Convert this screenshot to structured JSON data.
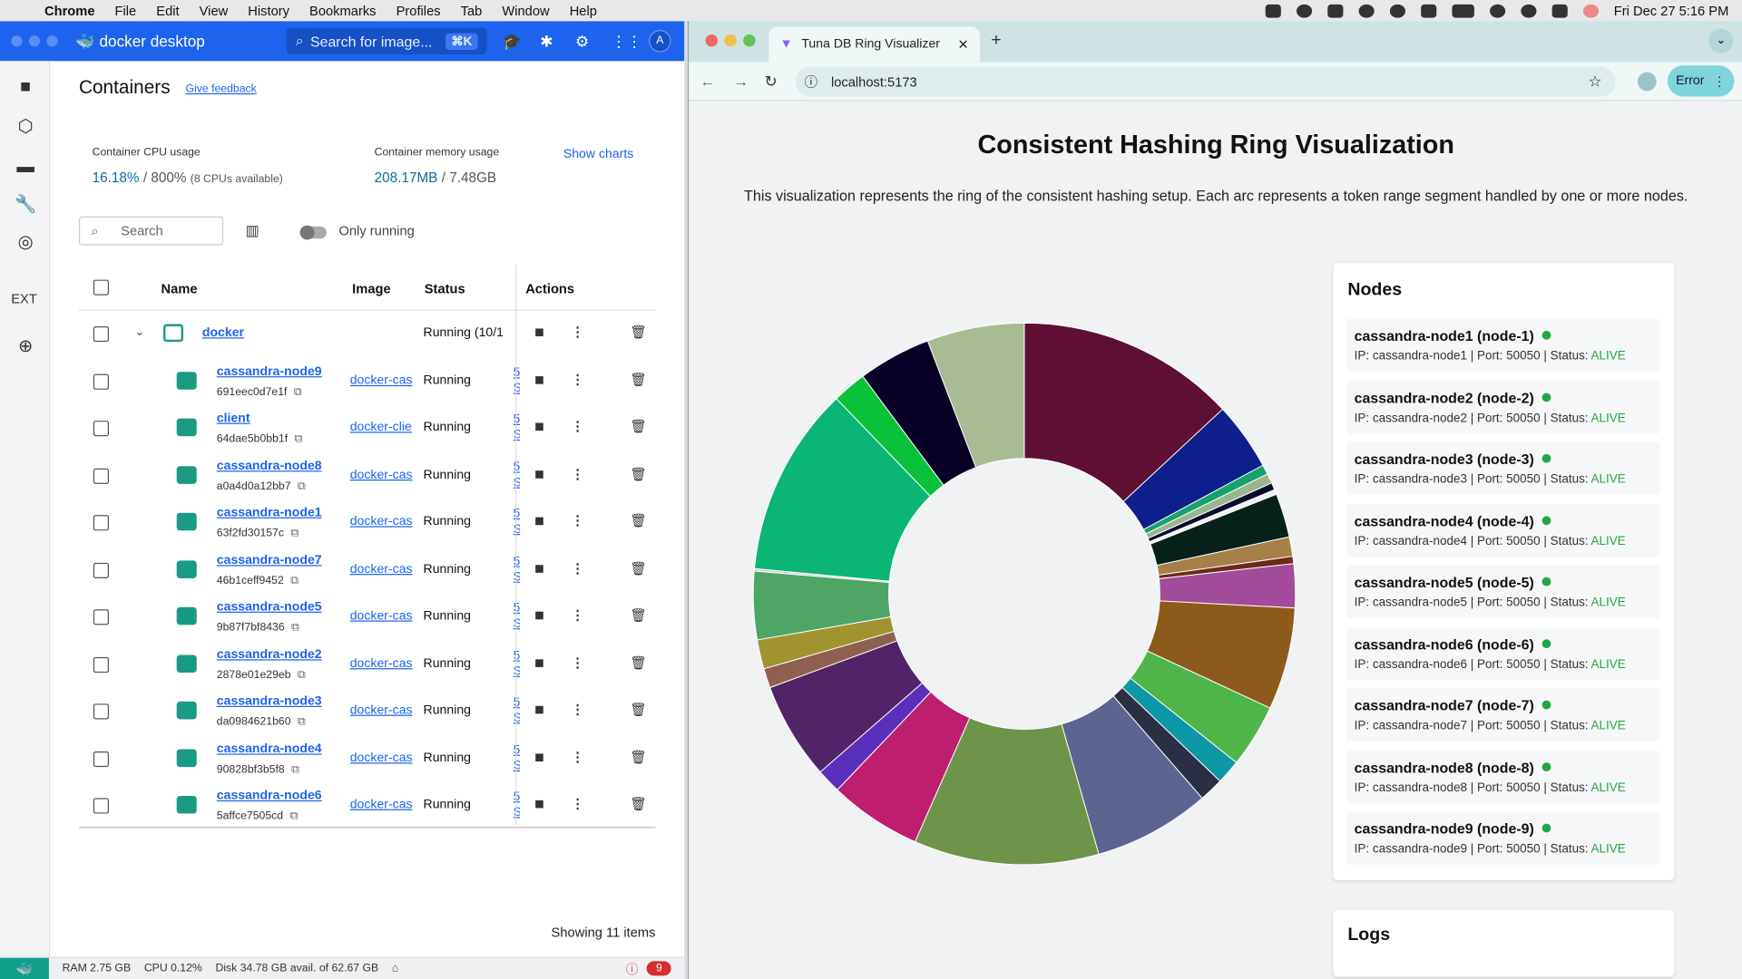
{
  "menubar": {
    "app": "Chrome",
    "items": [
      "File",
      "Edit",
      "View",
      "History",
      "Bookmarks",
      "Profiles",
      "Tab",
      "Window",
      "Help"
    ],
    "clock": "Fri Dec 27  5:16 PM"
  },
  "docker": {
    "logo": "docker desktop",
    "search_placeholder": "Search for image...",
    "search_shortcut": "⌘K",
    "avatar": "A",
    "page_title": "Containers",
    "feedback": "Give feedback",
    "cpu_label": "Container CPU usage",
    "cpu_value": "16.18%",
    "cpu_total": "/ 800%",
    "cpu_note": "(8 CPUs available)",
    "mem_label": "Container memory usage",
    "mem_value": "208.17MB",
    "mem_total": "/ 7.48GB",
    "show_charts": "Show charts",
    "search": "Search",
    "only_running": "Only running",
    "cols": {
      "name": "Name",
      "image": "Image",
      "status": "Status",
      "actions": "Actions"
    },
    "group": {
      "name": "docker",
      "status": "Running (10/1"
    },
    "rows": [
      {
        "name": "cassandra-node9",
        "id": "691eec0d7e1f",
        "image": "docker-cas",
        "status": "Running",
        "port": "5 S"
      },
      {
        "name": "client",
        "id": "64dae5b0bb1f",
        "image": "docker-clie",
        "status": "Running",
        "port": "5 S"
      },
      {
        "name": "cassandra-node8",
        "id": "a0a4d0a12bb7",
        "image": "docker-cas",
        "status": "Running",
        "port": "5 S"
      },
      {
        "name": "cassandra-node1",
        "id": "63f2fd30157c",
        "image": "docker-cas",
        "status": "Running",
        "port": "5 S"
      },
      {
        "name": "cassandra-node7",
        "id": "46b1ceff9452",
        "image": "docker-cas",
        "status": "Running",
        "port": "5 S"
      },
      {
        "name": "cassandra-node5",
        "id": "9b87f7bf8436",
        "image": "docker-cas",
        "status": "Running",
        "port": "5 S"
      },
      {
        "name": "cassandra-node2",
        "id": "2878e01e29eb",
        "image": "docker-cas",
        "status": "Running",
        "port": "5 S"
      },
      {
        "name": "cassandra-node3",
        "id": "da0984621b60",
        "image": "docker-cas",
        "status": "Running",
        "port": "5 S"
      },
      {
        "name": "cassandra-node4",
        "id": "90828bf3b5f8",
        "image": "docker-cas",
        "status": "Running",
        "port": "5 S"
      },
      {
        "name": "cassandra-node6",
        "id": "5affce7505cd",
        "image": "docker-cas",
        "status": "Running",
        "port": "5 S"
      }
    ],
    "showing": "Showing 11 items",
    "status_bar": {
      "ram": "RAM 2.75 GB",
      "cpu": "CPU 0.12%",
      "disk": "Disk 34.78 GB avail. of 62.67 GB",
      "notifications": "9"
    }
  },
  "chrome": {
    "tab_title": "Tuna DB Ring Visualizer",
    "url": "localhost:5173",
    "error_btn": "Error"
  },
  "page": {
    "title": "Consistent Hashing Ring Visualization",
    "description": "This visualization represents the ring of the consistent hashing setup. Each arc represents a token range segment handled by one or more nodes.",
    "nodes_heading": "Nodes",
    "logs_heading": "Logs",
    "nodes": [
      {
        "title": "cassandra-node1 (node-1)",
        "ip": "cassandra-node1",
        "port": "50050",
        "status": "ALIVE"
      },
      {
        "title": "cassandra-node2 (node-2)",
        "ip": "cassandra-node2",
        "port": "50050",
        "status": "ALIVE"
      },
      {
        "title": "cassandra-node3 (node-3)",
        "ip": "cassandra-node3",
        "port": "50050",
        "status": "ALIVE"
      },
      {
        "title": "cassandra-node4 (node-4)",
        "ip": "cassandra-node4",
        "port": "50050",
        "status": "ALIVE"
      },
      {
        "title": "cassandra-node5 (node-5)",
        "ip": "cassandra-node5",
        "port": "50050",
        "status": "ALIVE"
      },
      {
        "title": "cassandra-node6 (node-6)",
        "ip": "cassandra-node6",
        "port": "50050",
        "status": "ALIVE"
      },
      {
        "title": "cassandra-node7 (node-7)",
        "ip": "cassandra-node7",
        "port": "50050",
        "status": "ALIVE"
      },
      {
        "title": "cassandra-node8 (node-8)",
        "ip": "cassandra-node8",
        "port": "50050",
        "status": "ALIVE"
      },
      {
        "title": "cassandra-node9 (node-9)",
        "ip": "cassandra-node9",
        "port": "50050",
        "status": "ALIVE"
      }
    ]
  },
  "chart_data": {
    "type": "pie",
    "donut": true,
    "segments_deg": [
      {
        "value": 45,
        "color": "#5e0f33"
      },
      {
        "value": 14,
        "color": "#0c1f8a"
      },
      {
        "value": 2,
        "color": "#15a36b"
      },
      {
        "value": 2,
        "color": "#9ab58f"
      },
      {
        "value": 1.5,
        "color": "#0a0a2e"
      },
      {
        "value": 1,
        "color": "#f0f0f0"
      },
      {
        "value": 9,
        "color": "#062119"
      },
      {
        "value": 4,
        "color": "#a58048"
      },
      {
        "value": 1.5,
        "color": "#6b2a1a"
      },
      {
        "value": 9,
        "color": "#a24b9a"
      },
      {
        "value": 21,
        "color": "#8e5a1b"
      },
      {
        "value": 13,
        "color": "#4fb548"
      },
      {
        "value": 5,
        "color": "#0c98a6"
      },
      {
        "value": 5,
        "color": "#2b2f44"
      },
      {
        "value": 24,
        "color": "#5c6590"
      },
      {
        "value": 38,
        "color": "#6d9448"
      },
      {
        "value": 19,
        "color": "#bd1e6e"
      },
      {
        "value": 5,
        "color": "#5a2fbc"
      },
      {
        "value": 20,
        "color": "#512468"
      },
      {
        "value": 4,
        "color": "#8f6050"
      },
      {
        "value": 6,
        "color": "#a09430"
      },
      {
        "value": 14,
        "color": "#4ea566"
      },
      {
        "value": 0.5,
        "color": "#cfcfcf"
      },
      {
        "value": 39,
        "color": "#0bb576"
      },
      {
        "value": 7,
        "color": "#0ac23a"
      },
      {
        "value": 15,
        "color": "#090028"
      },
      {
        "value": 20,
        "color": "#a8bb92"
      }
    ]
  }
}
